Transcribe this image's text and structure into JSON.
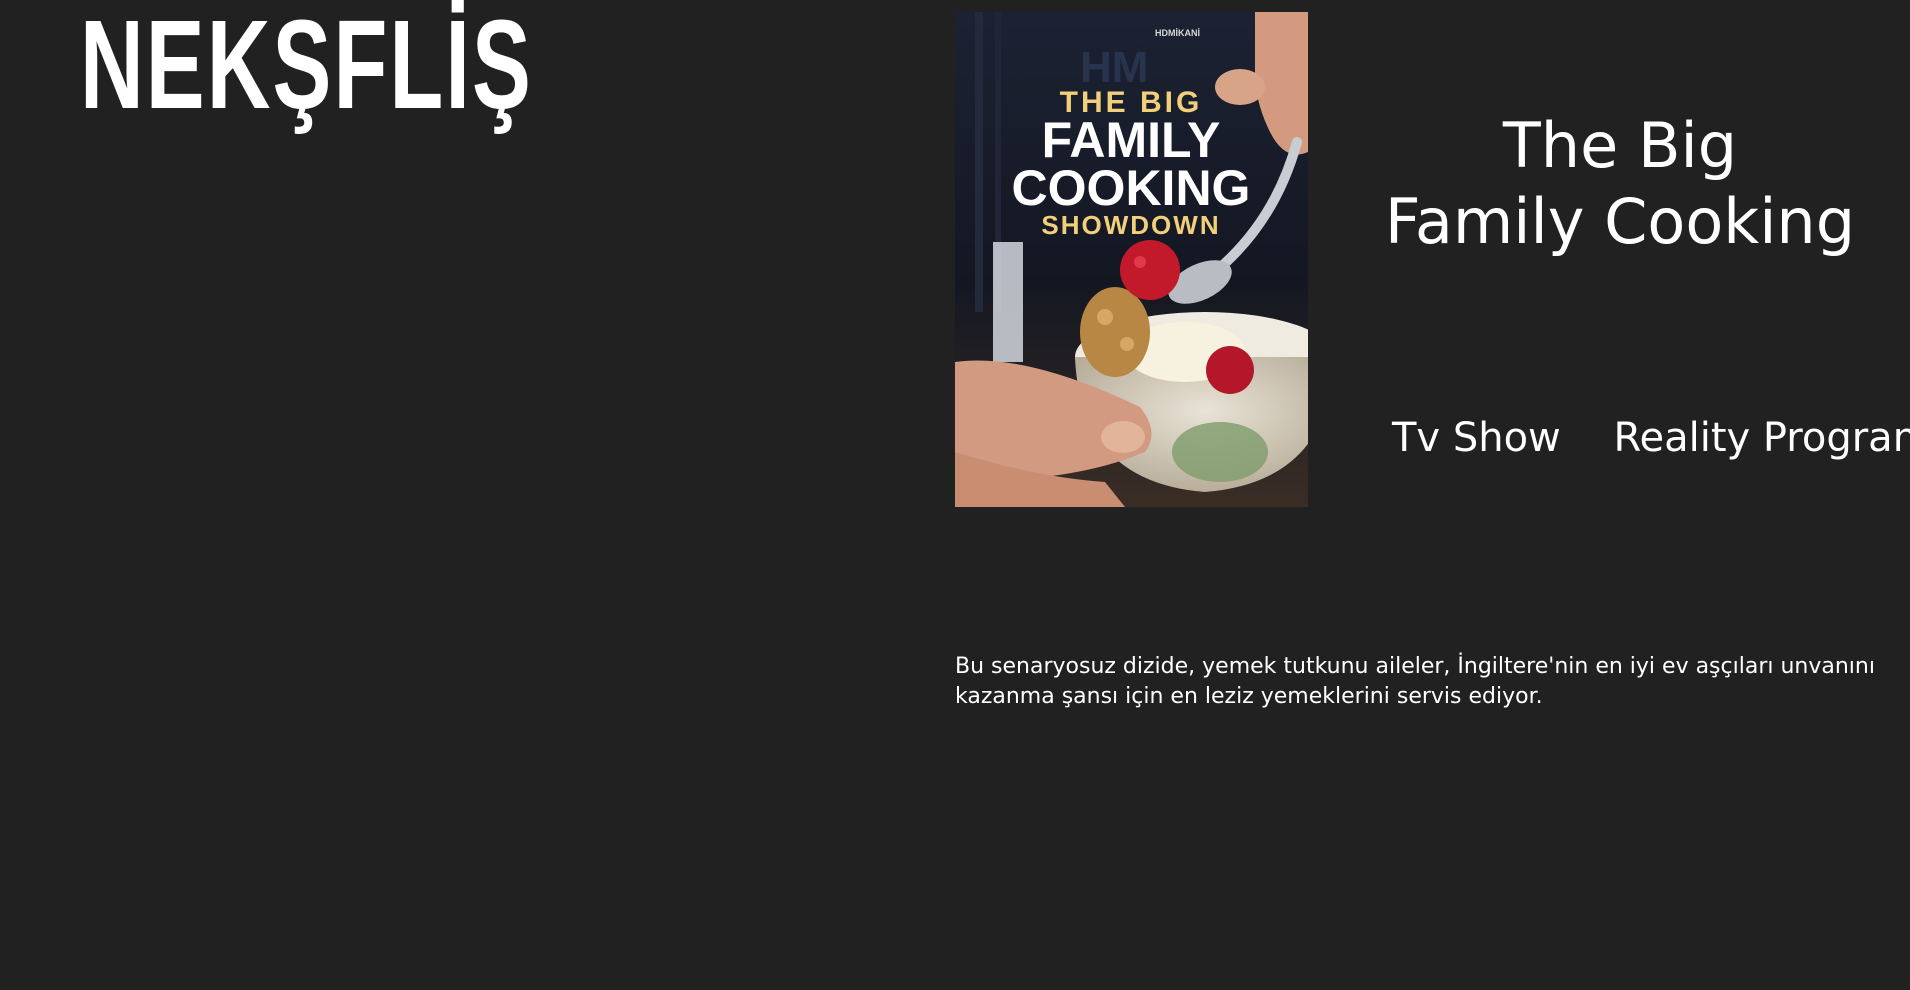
{
  "brand": {
    "logo_text": "NEKŞFLİŞ"
  },
  "show": {
    "title_line1": "The Big",
    "title_line2": "Family Cooking",
    "tags": [
      "Tv Show",
      "Reality Program"
    ],
    "description": "Bu senaryosuz dizide, yemek tutkunu aileler, İngiltere'nin en iyi ev aşçıları unvanını kazanma şansı için en leziz yemeklerini servis ediyor."
  },
  "poster": {
    "badge": "HDMİKANİ",
    "line1": "THE BIG",
    "line2": "FAMILY",
    "line3": "COOKING",
    "line4": "SHOWDOWN"
  },
  "colors": {
    "background": "#212121",
    "text": "#ffffff",
    "poster_gold": "#f2cf7a"
  }
}
